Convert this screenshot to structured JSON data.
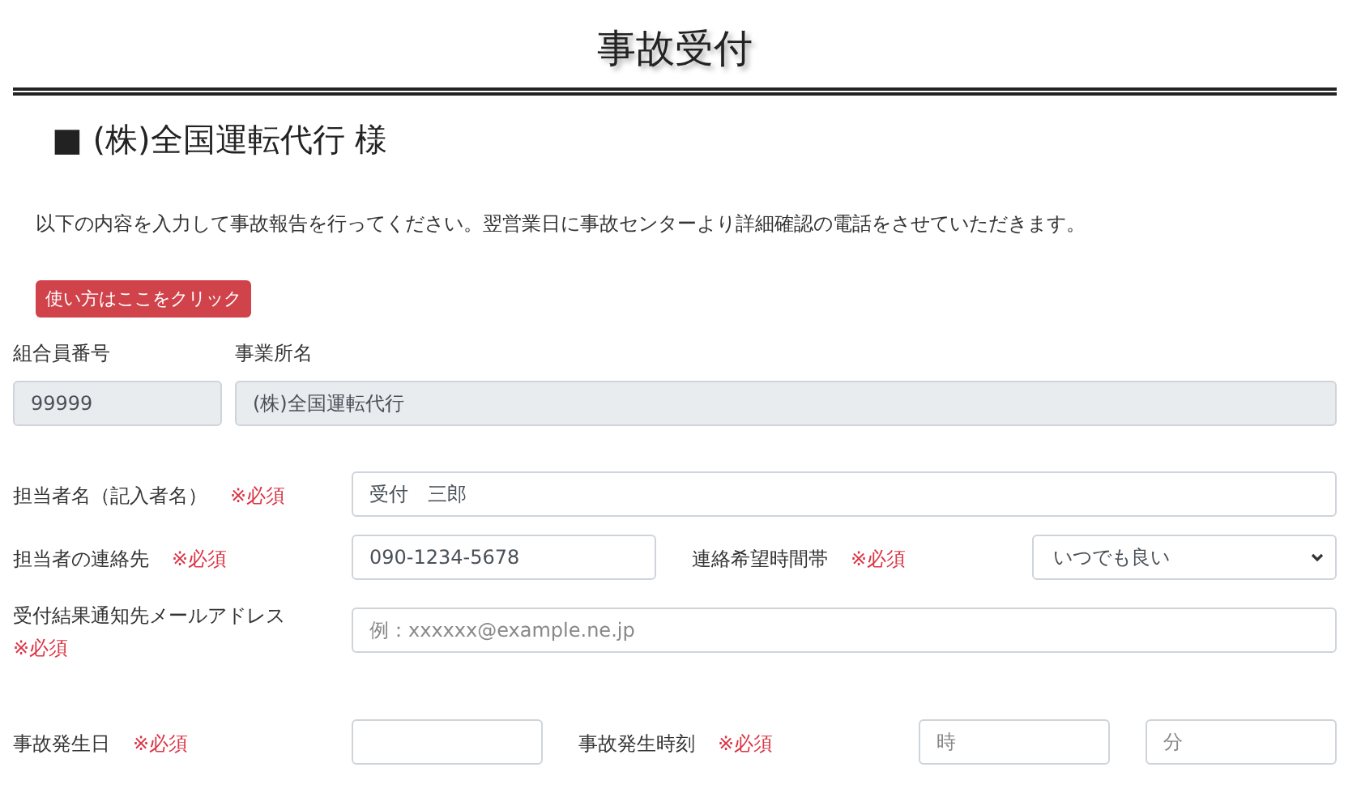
{
  "title": "事故受付",
  "heading": "■ (株)全国運転代行 様",
  "intro": "以下の内容を入力して事故報告を行ってください。翌営業日に事故センターより詳細確認の電話をさせていただきます。",
  "help_button": "使い方はここをクリック",
  "readonly_fields": [
    {
      "label": "組合員番号",
      "value": "99999"
    },
    {
      "label": "事業所名",
      "value": "(株)全国運転代行"
    }
  ],
  "rows": [
    {
      "label": "担当者名（記入者名）",
      "required": "※必須",
      "fields": [
        {
          "kind": "text",
          "value": "受付　三郎"
        }
      ]
    },
    {
      "label": "担当者の連絡先",
      "required": "※必須",
      "fields": [
        {
          "kind": "text",
          "value": "090-1234-5678"
        }
      ],
      "second": {
        "label": "連絡希望時間帯",
        "required": "※必須",
        "fields": [
          {
            "kind": "select",
            "value": "いつでも良い"
          }
        ]
      }
    },
    {
      "label": "受付結果通知先メールアドレス",
      "required": "※必須",
      "fields": [
        {
          "kind": "text",
          "placeholder": "例：xxxxxx@example.ne.jp"
        }
      ]
    },
    {
      "label": "事故発生日",
      "required": "※必須",
      "fields": [
        {
          "kind": "text"
        }
      ],
      "second": {
        "label": "事故発生時刻",
        "required": "※必須",
        "fields": [
          {
            "kind": "text",
            "placeholder": "時"
          },
          {
            "kind": "text",
            "placeholder": "分"
          }
        ]
      }
    }
  ]
}
